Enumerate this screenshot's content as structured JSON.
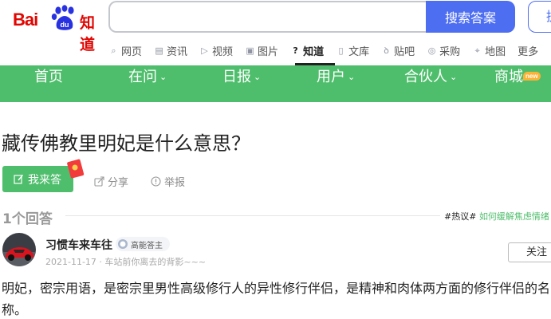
{
  "header": {
    "logo": {
      "bai": "Bai",
      "du": "du",
      "zhidao": "知道"
    },
    "search": {
      "value": "",
      "button_label": "搜索答案"
    },
    "ask_button_label": "提问",
    "nav_links": [
      {
        "label": "网页",
        "icon": "search-icon"
      },
      {
        "label": "资讯",
        "icon": "news-icon"
      },
      {
        "label": "视频",
        "icon": "video-icon"
      },
      {
        "label": "图片",
        "icon": "image-icon"
      },
      {
        "label": "知道",
        "icon": "question-icon",
        "active": true
      },
      {
        "label": "文库",
        "icon": "doc-icon"
      },
      {
        "label": "贴吧",
        "icon": "tieba-icon"
      },
      {
        "label": "采购",
        "icon": "purchase-icon"
      },
      {
        "label": "地图",
        "icon": "map-pin-icon"
      },
      {
        "label": "更多",
        "icon": ""
      }
    ]
  },
  "green_nav": {
    "items": [
      {
        "label": "首页",
        "has_chevron": false
      },
      {
        "label": "在问",
        "has_chevron": true
      },
      {
        "label": "日报",
        "has_chevron": true
      },
      {
        "label": "用户",
        "has_chevron": true
      },
      {
        "label": "合伙人",
        "has_chevron": true
      },
      {
        "label": "商城",
        "has_chevron": false
      }
    ],
    "new_badge": "new",
    "chevron": "⌄",
    "color": "#4fbe6c"
  },
  "question": {
    "title": "藏传佛教里明妃是什么意思？",
    "answer_button": "我来答",
    "share": "分享",
    "report": "举报"
  },
  "answers": {
    "count_label": "1个回答",
    "hot_tag": "#热议#",
    "hot_link": "如何缓解焦虑情绪"
  },
  "answer": {
    "author": "习惯车来车往",
    "medal_label": "高能答主",
    "meta": "2021-11-17 · 车站前你离去的背影~~~",
    "follow_label": "关注",
    "text": "明妃，密宗用语，是密宗里男性高级修行人的异性修行伴侣，是精神和肉体两方面的修行伴侣的名称。"
  },
  "colors": {
    "brand_red": "#e10602",
    "accent_blue": "#4e6ef2",
    "green": "#4fbe6c"
  }
}
